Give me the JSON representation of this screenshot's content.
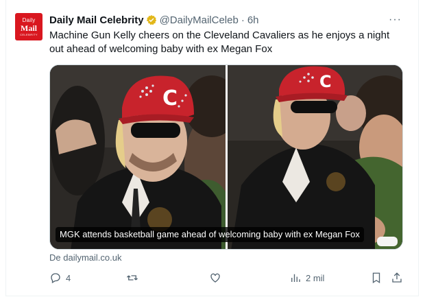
{
  "author": {
    "name": "Daily Mail Celebrity",
    "handle": "@DailyMailCeleb",
    "separator": "·",
    "time": "6h",
    "avatar": {
      "line1": "Daily",
      "line2": "Mail",
      "line3": "CELEBRITY",
      "color": "#d9171f"
    }
  },
  "tweet": {
    "text": "Machine Gun Kelly cheers on the Cleveland Cavaliers as he enjoys a night out ahead of welcoming baby with ex Megan Fox",
    "more_label": "···"
  },
  "media": {
    "caption": "MGK attends basketball game ahead of welcoming baby with ex Megan Fox",
    "cap_letter": "C"
  },
  "source": "De dailymail.co.uk",
  "actions": {
    "reply_count": "4",
    "views_count": "2 mil",
    "icons": [
      "reply-icon",
      "retweet-icon",
      "like-icon",
      "views-icon",
      "bookmark-icon",
      "share-icon"
    ]
  },
  "colors": {
    "text": "#0f1419",
    "muted": "#536471",
    "verified": "#e2b719",
    "cap_red": "#c8232c"
  }
}
